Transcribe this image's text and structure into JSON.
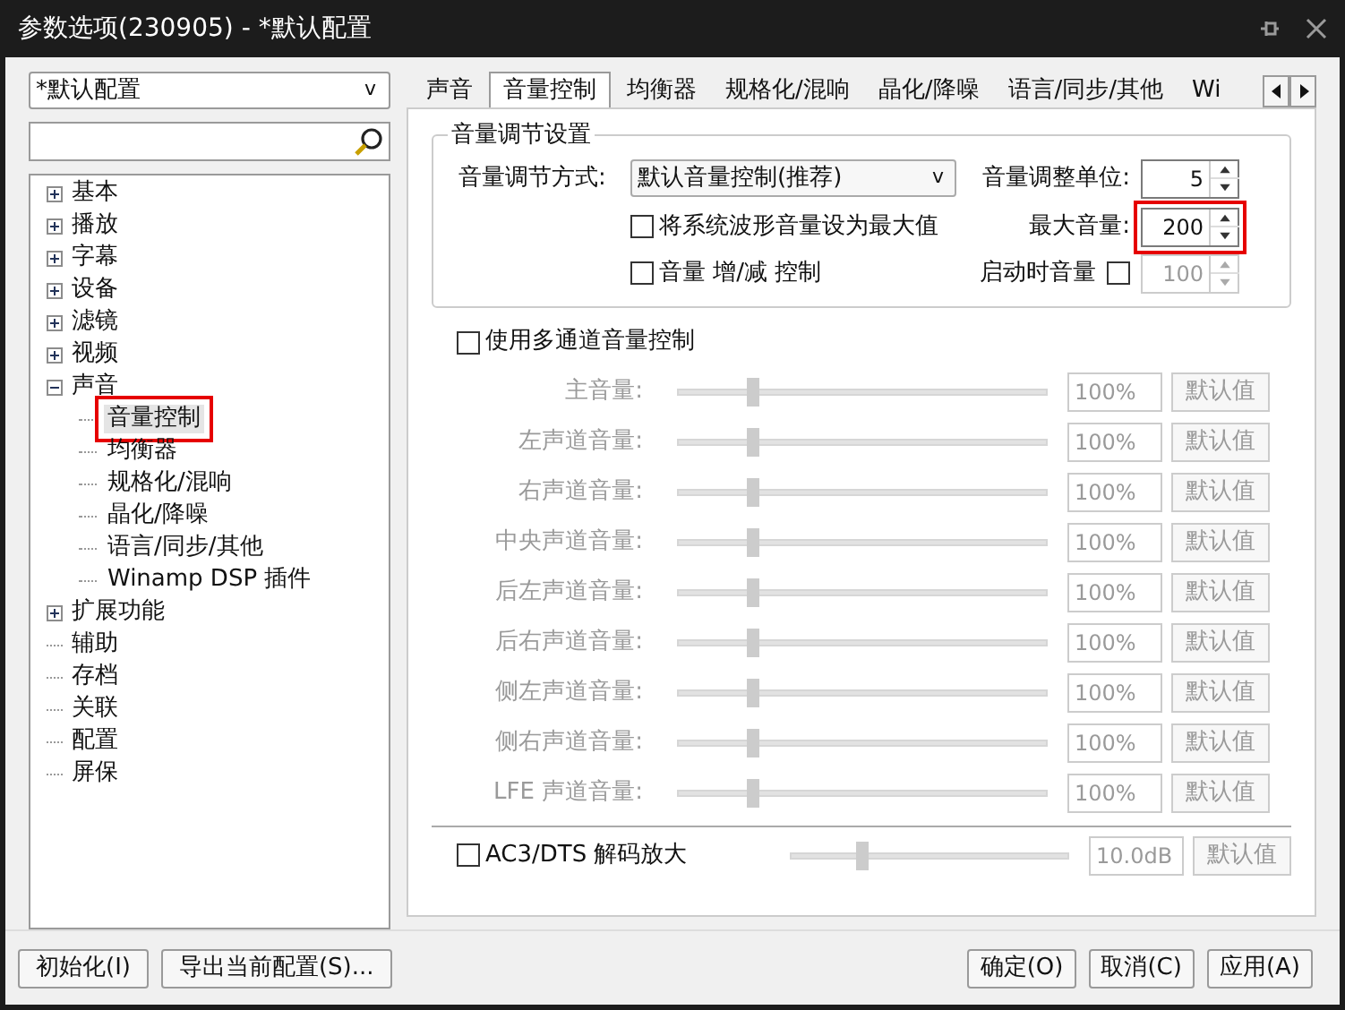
{
  "window": {
    "title": "参数选项(230905) - *默认配置"
  },
  "profile_dropdown": {
    "value": "*默认配置",
    "caret": "v"
  },
  "tree": [
    {
      "label": "基本",
      "kind": "group",
      "expanded": false,
      "selected": false
    },
    {
      "label": "播放",
      "kind": "group",
      "expanded": false,
      "selected": false
    },
    {
      "label": "字幕",
      "kind": "group",
      "expanded": false,
      "selected": false
    },
    {
      "label": "设备",
      "kind": "group",
      "expanded": false,
      "selected": false
    },
    {
      "label": "滤镜",
      "kind": "group",
      "expanded": false,
      "selected": false
    },
    {
      "label": "视频",
      "kind": "group",
      "expanded": false,
      "selected": false
    },
    {
      "label": "声音",
      "kind": "group",
      "expanded": true,
      "selected": false,
      "children": [
        {
          "label": "音量控制",
          "selected": true,
          "highlighted": true
        },
        {
          "label": "均衡器",
          "selected": false,
          "highlighted": false
        },
        {
          "label": "规格化/混响",
          "selected": false,
          "highlighted": false
        },
        {
          "label": "晶化/降噪",
          "selected": false,
          "highlighted": false
        },
        {
          "label": "语言/同步/其他",
          "selected": false,
          "highlighted": false
        },
        {
          "label": "Winamp DSP 插件",
          "selected": false,
          "highlighted": false
        }
      ]
    },
    {
      "label": "扩展功能",
      "kind": "group",
      "expanded": false,
      "selected": false
    },
    {
      "label": "辅助",
      "kind": "leaf",
      "selected": false
    },
    {
      "label": "存档",
      "kind": "leaf",
      "selected": false
    },
    {
      "label": "关联",
      "kind": "leaf",
      "selected": false
    },
    {
      "label": "配置",
      "kind": "leaf",
      "selected": false
    },
    {
      "label": "屏保",
      "kind": "leaf",
      "selected": false
    }
  ],
  "tabs": [
    {
      "label": "声音",
      "selected": false
    },
    {
      "label": "音量控制",
      "selected": true
    },
    {
      "label": "均衡器",
      "selected": false
    },
    {
      "label": "规格化/混响",
      "selected": false
    },
    {
      "label": "晶化/降噪",
      "selected": false
    },
    {
      "label": "语言/同步/其他",
      "selected": false
    },
    {
      "label": "Wi",
      "selected": false
    }
  ],
  "volume_settings": {
    "title": "音量调节设置",
    "mode_label": "音量调节方式:",
    "mode_value": "默认音量控制(推荐)",
    "mode_caret": "v",
    "step_label": "音量调整单位:",
    "step_value": "5",
    "max_label": "最大音量:",
    "max_value": "200",
    "max_highlighted": true,
    "checkboxes": [
      {
        "label": "将系统波形音量设为最大值",
        "checked": false
      },
      {
        "label": "音量 增/减 控制",
        "checked": false
      }
    ],
    "startup_label": "启动时音量",
    "startup_checked": false,
    "startup_value": "100"
  },
  "multichannel": {
    "label": "使用多通道音量控制",
    "checked": false,
    "channels": [
      {
        "name": "主音量:",
        "level": 0.2,
        "value": "100%",
        "button": "默认值"
      },
      {
        "name": "左声道音量:",
        "level": 0.2,
        "value": "100%",
        "button": "默认值"
      },
      {
        "name": "右声道音量:",
        "level": 0.2,
        "value": "100%",
        "button": "默认值"
      },
      {
        "name": "中央声道音量:",
        "level": 0.2,
        "value": "100%",
        "button": "默认值"
      },
      {
        "name": "后左声道音量:",
        "level": 0.2,
        "value": "100%",
        "button": "默认值"
      },
      {
        "name": "后右声道音量:",
        "level": 0.2,
        "value": "100%",
        "button": "默认值"
      },
      {
        "name": "侧左声道音量:",
        "level": 0.2,
        "value": "100%",
        "button": "默认值"
      },
      {
        "name": "侧右声道音量:",
        "level": 0.2,
        "value": "100%",
        "button": "默认值"
      },
      {
        "name": "LFE 声道音量:",
        "level": 0.2,
        "value": "100%",
        "button": "默认值"
      }
    ]
  },
  "ac3": {
    "label": "AC3/DTS 解码放大",
    "checked": false,
    "level": 0.25,
    "value": "10.0dB",
    "button": "默认值"
  },
  "footer_left": [
    "初始化(I)",
    "导出当前配置(S)..."
  ],
  "footer_right": [
    "确定(O)",
    "取消(C)",
    "应用(A)"
  ]
}
